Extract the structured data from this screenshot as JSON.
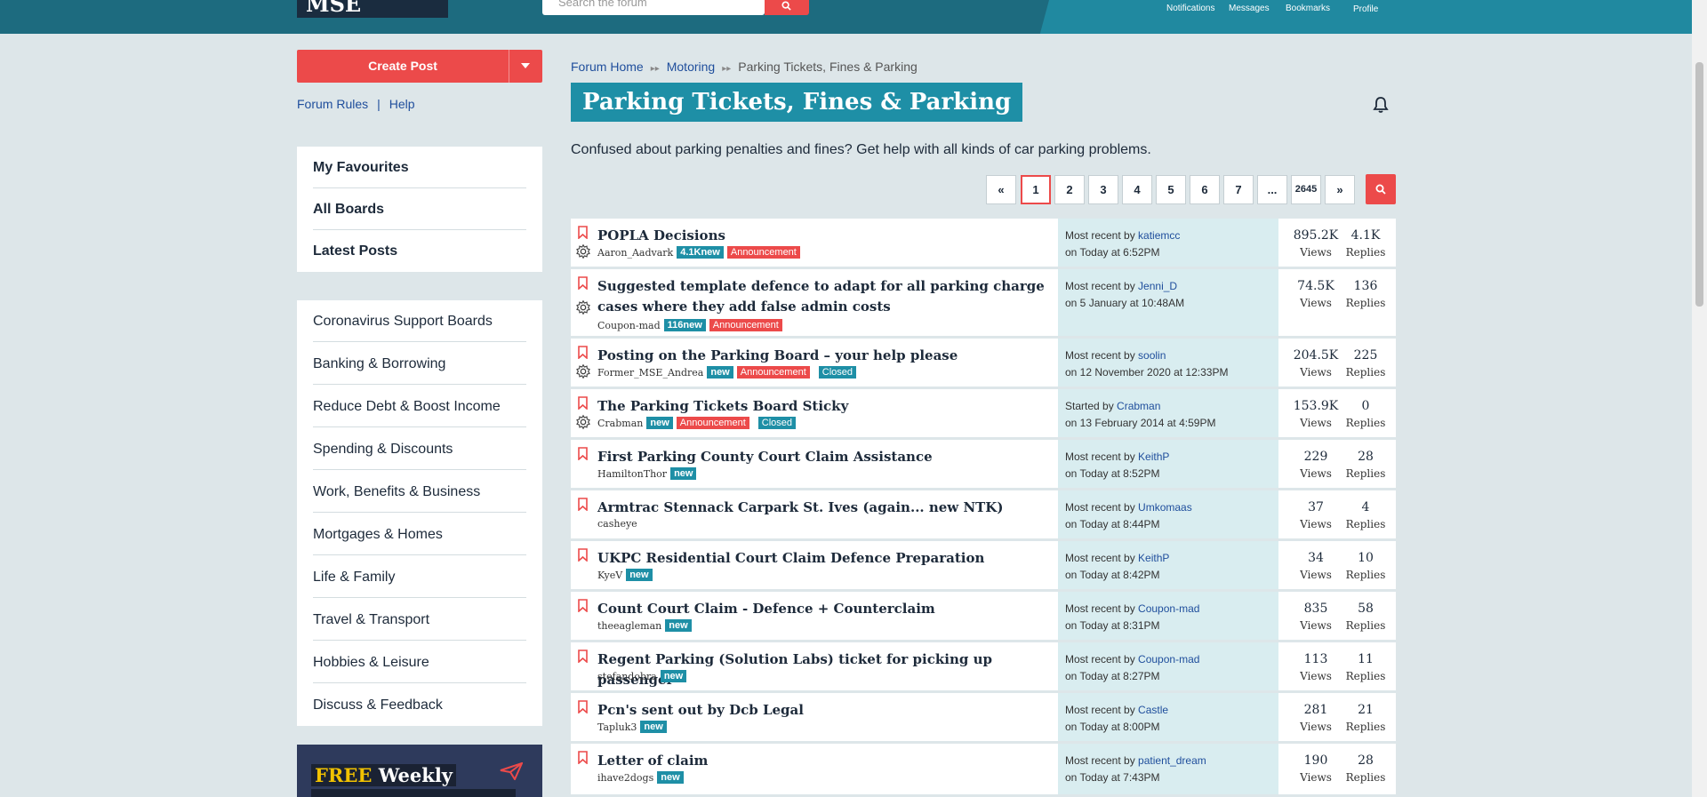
{
  "header": {
    "logo": "MSE Forum",
    "search_placeholder": "Search the forum",
    "nav": [
      "Notifications",
      "Messages",
      "Bookmarks",
      "Profile"
    ]
  },
  "sidebar": {
    "create_post": "Create Post",
    "forum_rules": "Forum Rules",
    "separator": "|",
    "help": "Help",
    "quick_links": [
      "My Favourites",
      "All Boards",
      "Latest Posts"
    ],
    "categories": [
      "Coronavirus Support Boards",
      "Banking & Borrowing",
      "Reduce Debt & Boost Income",
      "Spending & Discounts",
      "Work, Benefits & Business",
      "Mortgages & Homes",
      "Life & Family",
      "Travel & Transport",
      "Hobbies & Leisure",
      "Discuss & Feedback"
    ],
    "promo": {
      "highlight": "FREE",
      "text": "Weekly"
    }
  },
  "breadcrumb": [
    "Forum Home",
    "Motoring",
    "Parking Tickets, Fines & Parking"
  ],
  "board": {
    "title": "Parking Tickets, Fines & Parking",
    "description": "Confused about parking penalties and fines? Get help with all kinds of car parking problems."
  },
  "pagination": [
    "«",
    "1",
    "2",
    "3",
    "4",
    "5",
    "6",
    "7",
    "...",
    "2645",
    "»"
  ],
  "pagination_current": "1",
  "topics": [
    {
      "title": "POPLA Decisions",
      "author": "Aaron_Aadvark",
      "new": "4.1Knew",
      "announcement": "Announcement",
      "closed": "",
      "recent_prefix": "Most recent by",
      "recent_user": "katiemcc",
      "recent_time": "on Today at 6:52PM",
      "views": "895.2K",
      "replies": "4.1K"
    },
    {
      "title": "Suggested template defence to adapt for all parking charge cases where they add false admin costs",
      "author": "Coupon-mad",
      "new": "116new",
      "announcement": "Announcement",
      "closed": "",
      "recent_prefix": "Most recent by",
      "recent_user": "Jenni_D",
      "recent_time": "on 5 January at 10:48AM",
      "views": "74.5K",
      "replies": "136"
    },
    {
      "title": "Posting on the Parking Board – your help please",
      "author": "Former_MSE_Andrea",
      "new": "new",
      "announcement": "Announcement",
      "closed": "Closed",
      "recent_prefix": "Most recent by",
      "recent_user": "soolin",
      "recent_time": "on 12 November 2020 at 12:33PM",
      "views": "204.5K",
      "replies": "225"
    },
    {
      "title": "The Parking Tickets Board Sticky",
      "author": "Crabman",
      "new": "new",
      "announcement": "Announcement",
      "closed": "Closed",
      "recent_prefix": "Started by",
      "recent_user": "Crabman",
      "recent_time": "on 13 February 2014 at 4:59PM",
      "views": "153.9K",
      "replies": "0"
    },
    {
      "title": "First Parking County Court Claim Assistance",
      "author": "HamiltonThor",
      "new": "new",
      "announcement": "",
      "closed": "",
      "recent_prefix": "Most recent by",
      "recent_user": "KeithP",
      "recent_time": "on Today at 8:52PM",
      "views": "229",
      "replies": "28"
    },
    {
      "title": "Armtrac Stennack Carpark St. Ives (again... new NTK)",
      "author": "casheye",
      "new": "",
      "announcement": "",
      "closed": "",
      "recent_prefix": "Most recent by",
      "recent_user": "Umkomaas",
      "recent_time": "on Today at 8:44PM",
      "views": "37",
      "replies": "4"
    },
    {
      "title": "UKPC Residential Court Claim Defence Preparation",
      "author": "KyeV",
      "new": "new",
      "announcement": "",
      "closed": "",
      "recent_prefix": "Most recent by",
      "recent_user": "KeithP",
      "recent_time": "on Today at 8:42PM",
      "views": "34",
      "replies": "10"
    },
    {
      "title": "Count Court Claim - Defence + Counterclaim",
      "author": "theeagleman",
      "new": "new",
      "announcement": "",
      "closed": "",
      "recent_prefix": "Most recent by",
      "recent_user": "Coupon-mad",
      "recent_time": "on Today at 8:31PM",
      "views": "835",
      "replies": "58"
    },
    {
      "title": "Regent Parking (Solution Labs) ticket for picking up passenger",
      "author": "stefandobra",
      "new": "new",
      "announcement": "",
      "closed": "",
      "recent_prefix": "Most recent by",
      "recent_user": "Coupon-mad",
      "recent_time": "on Today at 8:27PM",
      "views": "113",
      "replies": "11"
    },
    {
      "title": "Pcn's sent out by Dcb Legal",
      "author": "Tapluk3",
      "new": "new",
      "announcement": "",
      "closed": "",
      "recent_prefix": "Most recent by",
      "recent_user": "Castle",
      "recent_time": "on Today at 8:00PM",
      "views": "281",
      "replies": "21"
    },
    {
      "title": "Letter of claim",
      "author": "ihave2dogs",
      "new": "new",
      "announcement": "",
      "closed": "",
      "recent_prefix": "Most recent by",
      "recent_user": "patient_dream",
      "recent_time": "on Today at 7:43PM",
      "views": "190",
      "replies": "28"
    }
  ],
  "labels": {
    "views": "Views",
    "replies": "Replies"
  },
  "colors": {
    "header": "#1d6b7f",
    "accent": "#ec4a4a",
    "teal": "#1e8fa6",
    "background": "#dde6e9"
  }
}
